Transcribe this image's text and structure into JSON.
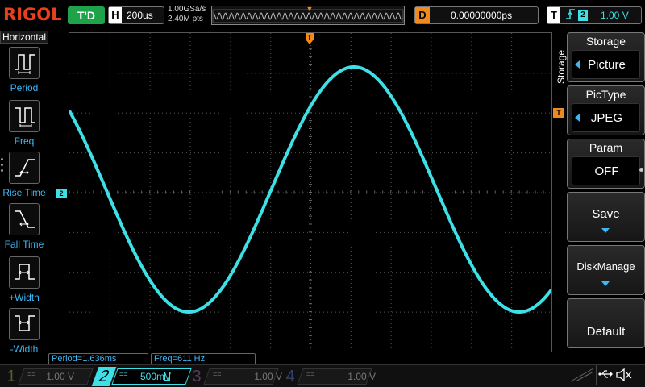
{
  "topbar": {
    "brand": "RIGOL",
    "run_state": "T'D",
    "horizontal": {
      "label": "H",
      "timebase": "200us"
    },
    "sampling": {
      "rate": "1.00GSa/s",
      "points": "2.40M pts"
    },
    "delay": {
      "label": "D",
      "value": "0.00000000ps"
    },
    "trigger": {
      "label": "T",
      "slope_icon": "rising-edge-icon",
      "source": "2",
      "level": "1.00 V"
    }
  },
  "left_menu": {
    "title": "Horizontal",
    "items": [
      {
        "label": "Period",
        "icon": "period-icon"
      },
      {
        "label": "Freq",
        "icon": "freq-icon"
      },
      {
        "label": "Rise Time",
        "icon": "rise-time-icon"
      },
      {
        "label": "Fall Time",
        "icon": "fall-time-icon"
      },
      {
        "label": "+Width",
        "icon": "plus-width-icon"
      },
      {
        "label": "-Width",
        "icon": "minus-width-icon"
      }
    ]
  },
  "screen": {
    "ch2_marker": "2",
    "trigger_level_marker": "T",
    "trigger_position_marker": "T",
    "trace_color": "#3de0e6"
  },
  "measurements": [
    {
      "text": "Period=1.636ms"
    },
    {
      "text": "Freq=611 Hz"
    }
  ],
  "right_menu": {
    "title": "Storage",
    "vertical_title": "Storage",
    "softkeys": [
      {
        "title": "Storage",
        "value": ""
      },
      {
        "title": "",
        "value": "Picture"
      },
      {
        "title": "PicType",
        "value": "JPEG"
      },
      {
        "title": "Param",
        "value": "OFF"
      },
      {
        "title": "",
        "value": "Save"
      },
      {
        "title": "",
        "value": "DiskManage"
      },
      {
        "title": "",
        "value": "Default"
      }
    ]
  },
  "channels": [
    {
      "num": "1",
      "coupling": "==",
      "scale": "1.00 V",
      "color": "#e8d21c"
    },
    {
      "num": "2",
      "coupling": "==",
      "scale": "500mV",
      "color": "#3de0e6"
    },
    {
      "num": "3",
      "coupling": "==",
      "scale": "1.00 V",
      "color": "#c03ad0"
    },
    {
      "num": "4",
      "coupling": "==",
      "scale": "1.00 V",
      "color": "#2a5fd8"
    }
  ]
}
